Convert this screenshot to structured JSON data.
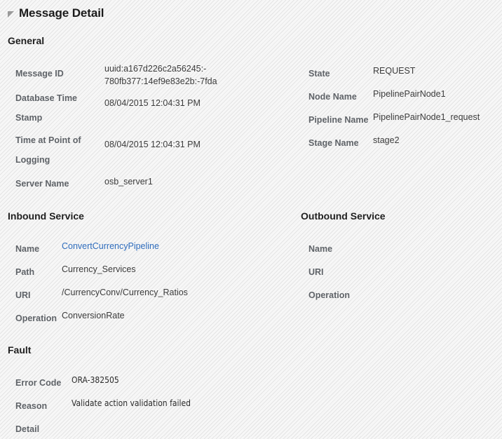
{
  "panel": {
    "title": "Message Detail",
    "disclosure_icon": "triangle-expanded-icon"
  },
  "sections": {
    "general": {
      "heading": "General",
      "left_fields": [
        {
          "label": "Message ID",
          "value": "uuid:a167d226c2a56245:-\n780fb377:14ef9e83e2b:-7fda"
        },
        {
          "label": "Database Time Stamp",
          "value": "08/04/2015 12:04:31 PM"
        },
        {
          "label": "Time at Point of Logging",
          "value": "08/04/2015 12:04:31 PM"
        },
        {
          "label": "Server Name",
          "value": "osb_server1"
        }
      ],
      "right_fields": [
        {
          "label": "State",
          "value": "REQUEST"
        },
        {
          "label": "Node Name",
          "value": "PipelinePairNode1"
        },
        {
          "label": "Pipeline Name",
          "value": "PipelinePairNode1_request"
        },
        {
          "label": "Stage Name",
          "value": "stage2"
        }
      ]
    },
    "inbound_service": {
      "heading": "Inbound Service",
      "fields": [
        {
          "label": "Name",
          "value": "ConvertCurrencyPipeline",
          "is_link": true
        },
        {
          "label": "Path",
          "value": "Currency_Services",
          "is_link": false
        },
        {
          "label": "URI",
          "value": "/CurrencyConv/Currency_Ratios",
          "is_link": false
        },
        {
          "label": "Operation",
          "value": "ConversionRate",
          "is_link": false
        }
      ]
    },
    "outbound_service": {
      "heading": "Outbound Service",
      "fields": [
        {
          "label": "Name",
          "value": ""
        },
        {
          "label": "URI",
          "value": ""
        },
        {
          "label": "Operation",
          "value": ""
        }
      ]
    },
    "fault": {
      "heading": "Fault",
      "fields": [
        {
          "label": "Error Code",
          "value": "ORA-382505"
        },
        {
          "label": "Reason",
          "value": "Validate action validation failed"
        },
        {
          "label": "Detail",
          "value": ""
        }
      ]
    }
  },
  "colors": {
    "link": "#2f6dbd",
    "label": "#5f6368",
    "value": "#3c3c3c",
    "heading": "#1f1f1f",
    "background": "#f7f7f7"
  }
}
